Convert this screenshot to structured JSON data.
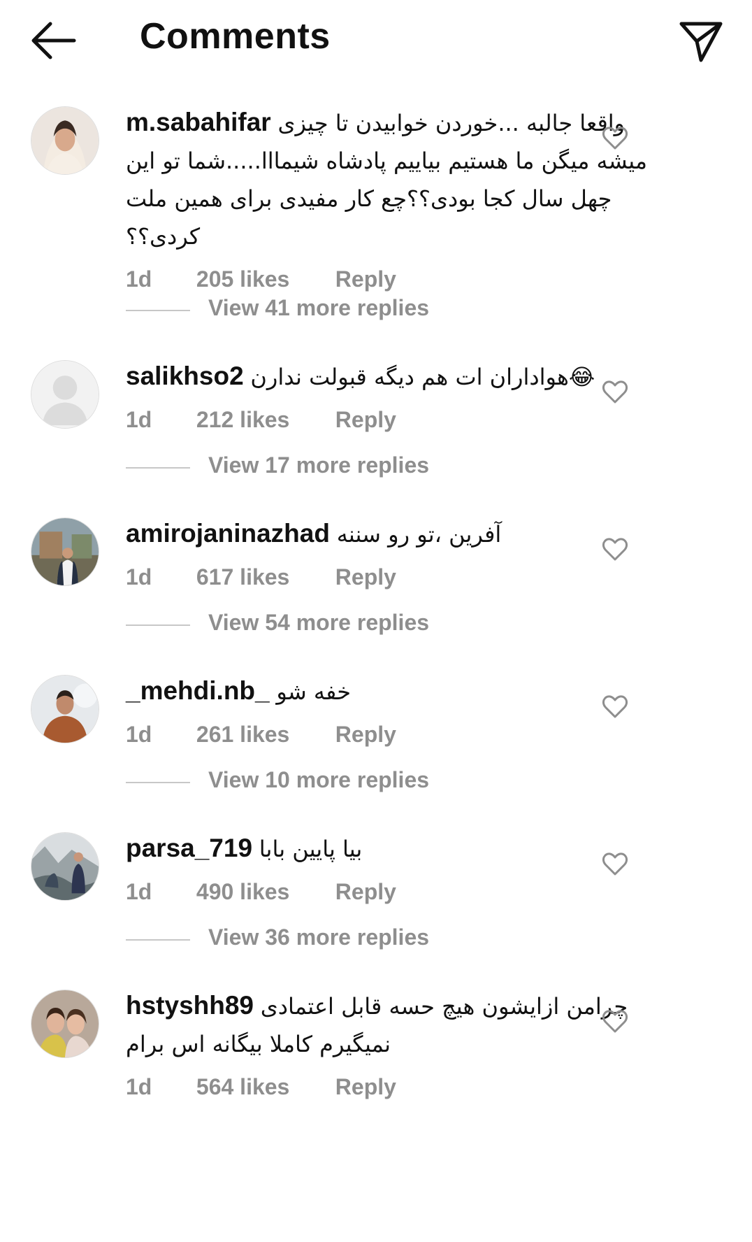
{
  "header": {
    "title": "Comments",
    "back_icon": "arrow-left-icon",
    "send_icon": "paper-plane-icon"
  },
  "comments": [
    {
      "username": "m.sabahifar",
      "text": "واقعا جالبه ...خوردن خوابیدن  تا چیزی میشه میگن ما هستیم بیاییم پادشاه شیمااا.....شما تو این چهل سال کجا بودی؟؟چع کار مفیدی برای همین ملت کردی؟؟",
      "time": "1d",
      "likes": "205 likes",
      "reply": "Reply",
      "view_replies": "View 41 more replies"
    },
    {
      "username": "salikhso2",
      "text": "😂هواداران ات هم دیگه قبولت ندارن",
      "time": "1d",
      "likes": "212 likes",
      "reply": "Reply",
      "view_replies": "View 17 more replies"
    },
    {
      "username": "amirojaninazhad",
      "text": "آفرین ،تو رو سننه",
      "time": "1d",
      "likes": "617 likes",
      "reply": "Reply",
      "view_replies": "View 54 more replies"
    },
    {
      "username": "_mehdi.nb_",
      "text": "خفه شو",
      "time": "1d",
      "likes": "261 likes",
      "reply": "Reply",
      "view_replies": "View 10 more replies"
    },
    {
      "username": "parsa_719",
      "text": "بیا پایین بابا",
      "time": "1d",
      "likes": "490 likes",
      "reply": "Reply",
      "view_replies": "View 36 more replies"
    },
    {
      "username": "hstyshh89",
      "text": "چرامن ازایشون هیچ حسه قابل اعتمادی نمیگیرم کاملا بیگانه اس برام",
      "time": "1d",
      "likes": "564 likes",
      "reply": "Reply"
    }
  ]
}
